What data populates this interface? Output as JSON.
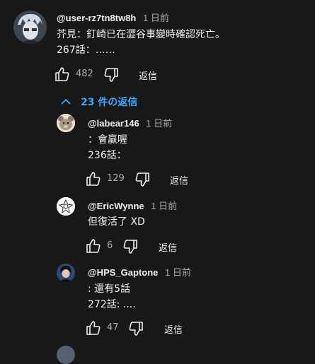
{
  "comment": {
    "handle": "@user-rz7tn8tw8h",
    "time": "1 日前",
    "lines": [
      "芥見：釘崎已在澀谷事變時確認死亡。",
      "267話：……"
    ],
    "likes": "482",
    "reply_label": "返信"
  },
  "replies_toggle": {
    "label": "23 件の返信"
  },
  "replies": [
    {
      "handle": "@labear146",
      "time": "1 日前",
      "lines": [
        "：會贏喔",
        "236話："
      ],
      "likes": "129",
      "reply_label": "返信"
    },
    {
      "handle": "@EricWynne",
      "time": "1 日前",
      "lines": [
        "但復活了 XD"
      ],
      "likes": "6",
      "reply_label": "返信"
    },
    {
      "handle": "@HPS_Gaptone",
      "time": "1 日前",
      "lines": [
        ": 還有5話",
        "272話: ...."
      ],
      "likes": "47",
      "reply_label": "返信"
    }
  ],
  "colors": {
    "background": "#181818",
    "link": "#3ea6ff",
    "muted": "#aaaaaa",
    "text": "#f1f1f1"
  }
}
